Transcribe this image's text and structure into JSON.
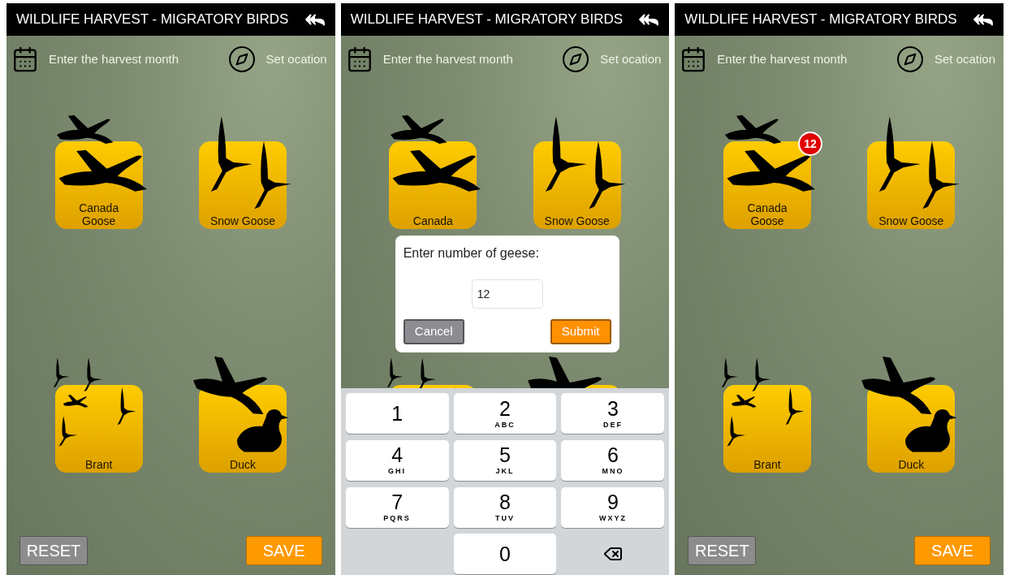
{
  "screens": [
    {
      "title": "WILDLIFE HARVEST - MIGRATORY BIRDS",
      "toolbar": {
        "month_label": "Enter the harvest month",
        "location_label": "Set ocation"
      },
      "species": [
        {
          "kind": "canada_goose",
          "label": "Canada Goose"
        },
        {
          "kind": "snow_goose",
          "label": "Snow Goose"
        },
        {
          "kind": "brant",
          "label": "Brant"
        },
        {
          "kind": "duck",
          "label": "Duck"
        }
      ],
      "buttons": {
        "reset": "RESET",
        "save": "SAVE"
      }
    },
    {
      "title": "WILDLIFE HARVEST - MIGRATORY BIRDS",
      "toolbar": {
        "month_label": "Enter the harvest month",
        "location_label": "Set ocation"
      },
      "species": [
        {
          "kind": "canada_goose",
          "label": "Canada"
        },
        {
          "kind": "snow_goose",
          "label": "Snow Goose"
        },
        {
          "kind": "brant"
        },
        {
          "kind": "duck"
        }
      ],
      "dialog": {
        "title": "Enter number of geese:",
        "value": "12",
        "cancel": "Cancel",
        "submit": "Submit"
      },
      "keypad": [
        {
          "kind": "digit",
          "digit": "1"
        },
        {
          "kind": "digit",
          "digit": "2",
          "letters": "ABC"
        },
        {
          "kind": "digit",
          "digit": "3",
          "letters": "DEF"
        },
        {
          "kind": "digit",
          "digit": "4",
          "letters": "GHI"
        },
        {
          "kind": "digit",
          "digit": "5",
          "letters": "JKL"
        },
        {
          "kind": "digit",
          "digit": "6",
          "letters": "MNO"
        },
        {
          "kind": "digit",
          "digit": "7",
          "letters": "PQRS"
        },
        {
          "kind": "digit",
          "digit": "8",
          "letters": "TUV"
        },
        {
          "kind": "digit",
          "digit": "9",
          "letters": "WXYZ"
        },
        {
          "kind": "blank"
        },
        {
          "kind": "digit",
          "digit": "0"
        },
        {
          "kind": "backspace"
        }
      ]
    },
    {
      "title": "WILDLIFE HARVEST - MIGRATORY BIRDS",
      "toolbar": {
        "month_label": "Enter the harvest month",
        "location_label": "Set ocation"
      },
      "species": [
        {
          "kind": "canada_goose",
          "label": "Canada Goose",
          "badge": "12"
        },
        {
          "kind": "snow_goose",
          "label": "Snow Goose"
        },
        {
          "kind": "brant",
          "label": "Brant"
        },
        {
          "kind": "duck",
          "label": "Duck"
        }
      ],
      "buttons": {
        "reset": "RESET",
        "save": "SAVE"
      }
    }
  ]
}
